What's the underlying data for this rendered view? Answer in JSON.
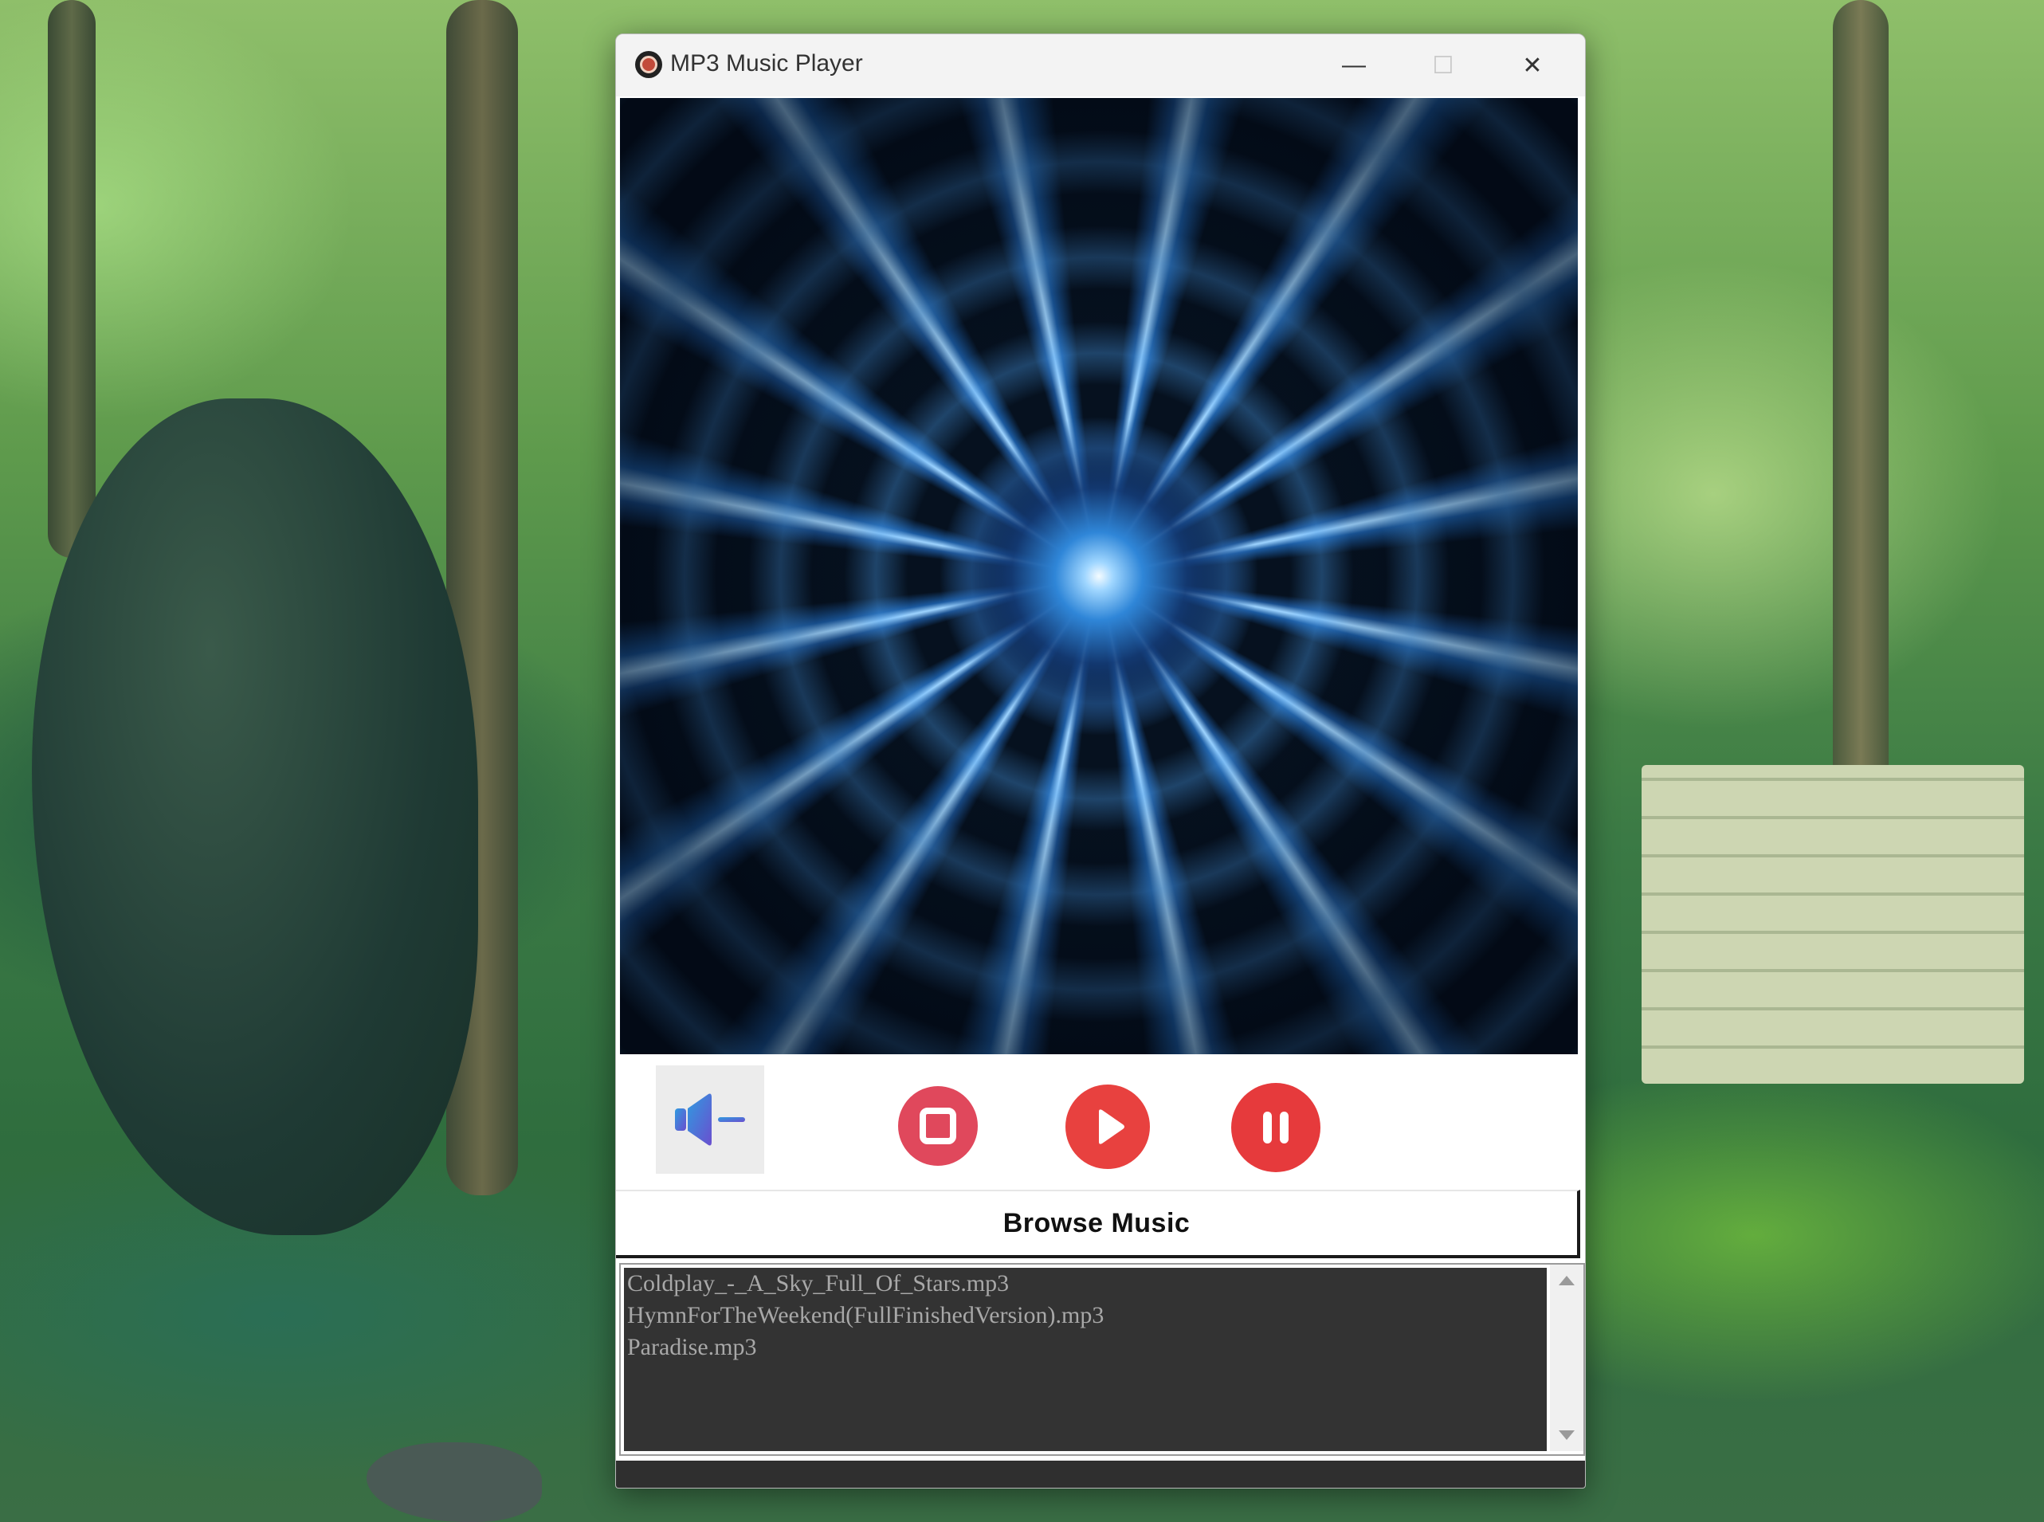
{
  "window": {
    "title": "MP3 Music Player",
    "controls": {
      "minimize_glyph": "—",
      "maximize_glyph": "☐",
      "close_glyph": "✕"
    }
  },
  "player": {
    "volume_icon": "speaker-low-icon",
    "buttons": [
      {
        "name": "stop",
        "icon": "stop-icon",
        "color": "#e0485c"
      },
      {
        "name": "play",
        "icon": "play-icon",
        "color": "#e8413f"
      },
      {
        "name": "pause",
        "icon": "pause-icon",
        "color": "#e63a3c"
      }
    ]
  },
  "browse": {
    "label": "Browse Music"
  },
  "playlist": {
    "items": [
      "Coldplay_-_A_Sky_Full_Of_Stars.mp3",
      "HymnForTheWeekend(FullFinishedVersion).mp3",
      "Paradise.mp3"
    ]
  },
  "colors": {
    "accent": "#e8413f",
    "listbox_bg": "#333333",
    "listbox_text": "#a8a8a8"
  }
}
